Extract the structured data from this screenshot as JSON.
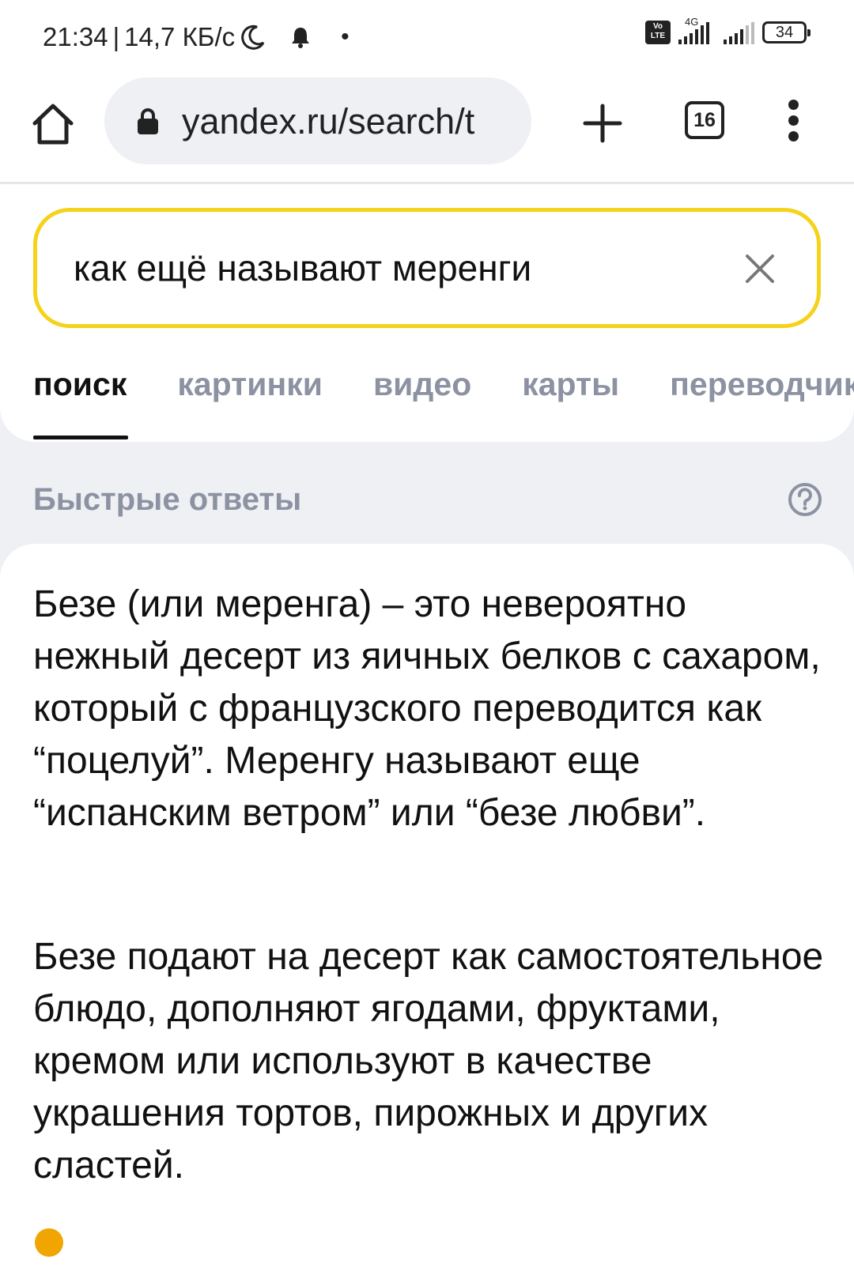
{
  "status_bar": {
    "time": "21:34",
    "separator": "|",
    "speed": "14,7 КБ/с",
    "network_type": "4G",
    "volte_badge": "Vo LTE",
    "battery_level": "34"
  },
  "browser": {
    "url": "yandex.ru/search/t",
    "tab_count": "16"
  },
  "search": {
    "query": "как ещё называют меренги"
  },
  "nav_tabs": [
    {
      "label": "поиск",
      "active": true
    },
    {
      "label": "картинки",
      "active": false
    },
    {
      "label": "видео",
      "active": false
    },
    {
      "label": "карты",
      "active": false
    },
    {
      "label": "переводчик",
      "active": false
    }
  ],
  "quick_answers": {
    "title": "Быстрые ответы",
    "paragraph_1": "Безе (или меренга) – это невероятно нежный десерт из яичных белков с сахаром, который с французского переводится как “поцелуй”. Меренгу называют еще “испанским ветром” или “безе любви”.",
    "paragraph_2": "Безе подают на десерт как самостоятельное блюдо, дополняют ягодами, фруктами, кремом или используют в качестве украшения тортов, пирожных и других сластей."
  },
  "colors": {
    "search_border": "#f6d21a",
    "inactive_tab": "#8c92a2",
    "page_background": "#eef0f4"
  }
}
